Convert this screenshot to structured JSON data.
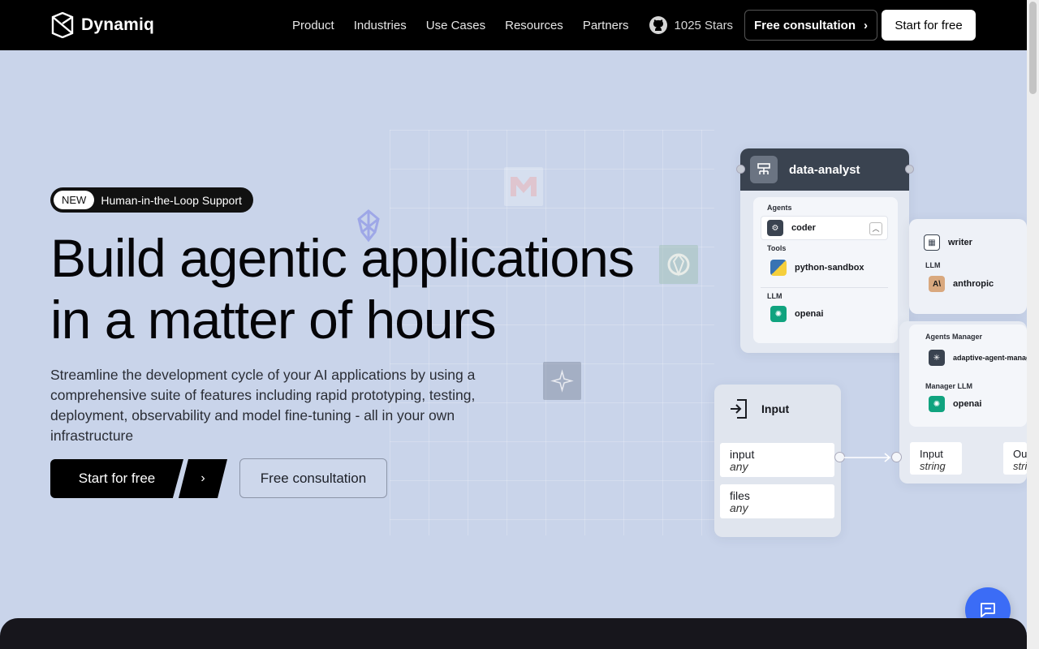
{
  "brand": {
    "name": "Dynamiq"
  },
  "nav": {
    "items": [
      "Product",
      "Industries",
      "Use Cases",
      "Resources",
      "Partners"
    ],
    "stars": "1025 Stars",
    "consult_label": "Free consultation",
    "start_label": "Start for free"
  },
  "hero": {
    "badge_new": "NEW",
    "badge_text": "Human-in-the-Loop Support",
    "title_line1": "Build agentic applications",
    "title_line2": "in a matter of hours",
    "subtitle": "Streamline the development cycle of your AI applications by using a comprehensive suite of features including rapid prototyping, testing, deployment, observability and model fine-tuning - all in your own infrastructure",
    "cta_start": "Start for free",
    "cta_consult": "Free consultation"
  },
  "workflow": {
    "analyst": {
      "title": "data-analyst",
      "agents_label": "Agents",
      "agent": "coder",
      "tools_label": "Tools",
      "tool": "python-sandbox",
      "llm_label": "LLM",
      "llm": "openai"
    },
    "writer": {
      "title": "writer",
      "llm_label": "LLM",
      "llm": "anthropic"
    },
    "manager": {
      "agents_label": "Agents Manager",
      "agent": "adaptive-agent-manage",
      "llm_label": "Manager LLM",
      "llm": "openai"
    },
    "input_node": {
      "title": "Input",
      "ports": [
        {
          "name": "input",
          "type": "any"
        },
        {
          "name": "files",
          "type": "any"
        }
      ]
    },
    "input_port": {
      "name": "Input",
      "type": "string"
    },
    "output_port": {
      "name": "Outp",
      "type": "strin"
    }
  },
  "colors": {
    "accent": "#3b6cf6",
    "bg": "#c9d4ea",
    "header": "#000000"
  }
}
